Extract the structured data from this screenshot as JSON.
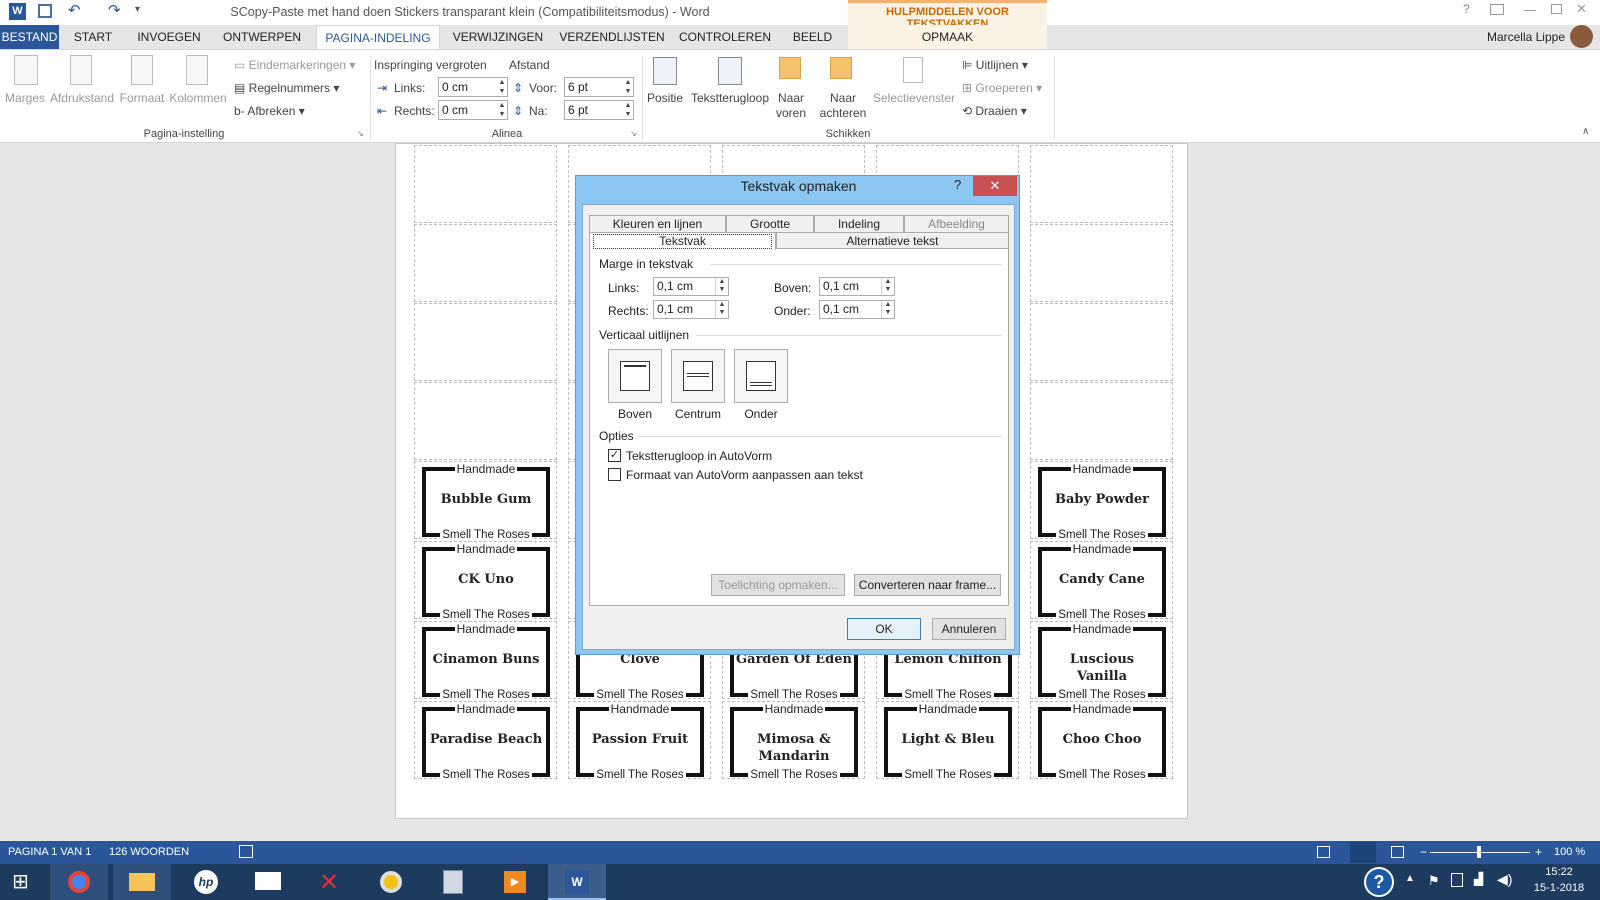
{
  "app": {
    "title": "SCopy-Paste met hand doen Stickers transparant klein (Compatibiliteitsmodus) - Word",
    "context_group": "HULPMIDDELEN VOOR TEKSTVAKKEN",
    "user": "Marcella Lippe",
    "help_glyph": "?"
  },
  "menu_tabs": [
    "BESTAND",
    "START",
    "INVOEGEN",
    "ONTWERPEN",
    "PAGINA-INDELING",
    "VERWIJZINGEN",
    "VERZENDLIJSTEN",
    "CONTROLEREN",
    "BEELD",
    "OPMAAK"
  ],
  "ribbon": {
    "page_setup": {
      "marges": "Marges",
      "afdrukstand": "Afdrukstand",
      "formaat": "Formaat",
      "kolommen": "Kolommen",
      "eindemarkeringen": "Eindemarkeringen",
      "regelnummers": "Regelnummers",
      "afbreken": "Afbreken",
      "group": "Pagina-instelling"
    },
    "paragraph": {
      "indent_title": "Inspringing vergroten",
      "spacing_title": "Afstand",
      "links_label": "Links:",
      "links_value": "0 cm",
      "rechts_label": "Rechts:",
      "rechts_value": "0 cm",
      "voor_label": "Voor:",
      "voor_value": "6 pt",
      "na_label": "Na:",
      "na_value": "6 pt",
      "group": "Alinea"
    },
    "arrange": {
      "positie": "Positie",
      "tekstterugloop": "Tekstterugloop",
      "naar_voren_1": "Naar",
      "naar_voren_2": "voren",
      "naar_achteren_1": "Naar",
      "naar_achteren_2": "achteren",
      "selectievenster": "Selectievenster",
      "uitlijnen": "Uitlijnen",
      "groeperen": "Groeperen",
      "draaien": "Draaien",
      "group": "Schikken"
    }
  },
  "labels_common": {
    "top": "Handmade",
    "bottom": "Smell The Roses"
  },
  "labels": [
    {
      "name": "Bubble Gum"
    },
    {
      "name": "CK Uno"
    },
    {
      "name": "Cinamon Buns"
    },
    {
      "name": "Paradise Beach"
    },
    {
      "name": "Clove"
    },
    {
      "name": "Passion Fruit"
    },
    {
      "name": "Garden Of Eden"
    },
    {
      "name": "Mimosa & Mandarin"
    },
    {
      "name": "Lemon Chiffon"
    },
    {
      "name": "Light & Bleu"
    },
    {
      "name": "Baby Powder"
    },
    {
      "name": "Candy Cane"
    },
    {
      "name": "Luscious Vanilla"
    },
    {
      "name": "Choo Choo"
    }
  ],
  "dialog": {
    "title": "Tekstvak opmaken",
    "help": "?",
    "close": "✕",
    "tabs_row1": [
      "Kleuren en lijnen",
      "Grootte",
      "Indeling",
      "Afbeelding"
    ],
    "tabs_row2": [
      "Tekstvak",
      "Alternatieve tekst"
    ],
    "margin_section": "Marge in tekstvak",
    "links_label": "Links:",
    "links_value": "0,1 cm",
    "rechts_label": "Rechts:",
    "rechts_value": "0,1 cm",
    "boven_label": "Boven:",
    "boven_value": "0,1 cm",
    "onder_label": "Onder:",
    "onder_value": "0,1 cm",
    "valign_section": "Verticaal uitlijnen",
    "valign_boven": "Boven",
    "valign_centrum": "Centrum",
    "valign_onder": "Onder",
    "options_section": "Opties",
    "opt_wrap": "Tekstterugloop in AutoVorm",
    "opt_wrap_checked": true,
    "opt_resize": "Formaat van AutoVorm aanpassen aan tekst",
    "opt_resize_checked": false,
    "btn_toelichting": "Toelichting opmaken...",
    "btn_converteren": "Converteren naar frame...",
    "btn_ok": "OK",
    "btn_annuleren": "Annuleren"
  },
  "status": {
    "page": "PAGINA 1 VAN 1",
    "words": "126 WOORDEN",
    "zoom": "100 %"
  },
  "taskbar": {
    "time": "15:22",
    "date": "15-1-2018"
  }
}
